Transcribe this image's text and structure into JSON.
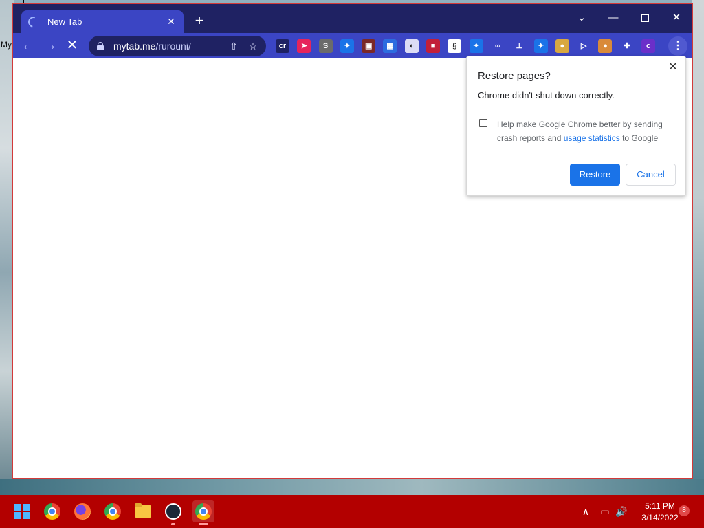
{
  "desktop": {
    "label": "My"
  },
  "tab": {
    "title": "New Tab",
    "close": "✕"
  },
  "new_tab": "+",
  "window_controls": {
    "tab_search": "⌄",
    "minimize": "—",
    "close": "✕"
  },
  "nav": {
    "back": "←",
    "forward": "→",
    "stop": "✕"
  },
  "address": {
    "domain": "mytab.me",
    "path": "/rurouni/"
  },
  "omnibox_icons": {
    "share": "⇧",
    "bookmark": "☆"
  },
  "extensions": [
    {
      "name": "cr-extension-icon",
      "text": "cr",
      "color": "#1f2263"
    },
    {
      "name": "pointer-extension-icon",
      "text": "➤",
      "color": "#e6245c"
    },
    {
      "name": "s-extension-icon",
      "text": "S",
      "color": "#6b6b6b"
    },
    {
      "name": "puzzle-blue-extension-icon",
      "text": "✦",
      "color": "#1a73e8"
    },
    {
      "name": "red-box-extension-icon",
      "text": "▣",
      "color": "#7a2828"
    },
    {
      "name": "grid-extension-icon",
      "text": "▦",
      "color": "#2d6cdf"
    },
    {
      "name": "flag-extension-icon",
      "text": "◐",
      "color": "#dcdcf5"
    },
    {
      "name": "red-square-extension-icon",
      "text": "■",
      "color": "#c21f3a"
    },
    {
      "name": "clip-extension-icon",
      "text": "§",
      "color": "#ffffff"
    },
    {
      "name": "puzzle-blue-2-extension-icon",
      "text": "✦",
      "color": "#1a73e8"
    },
    {
      "name": "link-extension-icon",
      "text": "∞",
      "color": "#3b45c4"
    },
    {
      "name": "stamp-extension-icon",
      "text": "⊥",
      "color": "#3b45c4"
    },
    {
      "name": "puzzle-blue-3-extension-icon",
      "text": "✦",
      "color": "#1a73e8"
    },
    {
      "name": "doge-extension-icon",
      "text": "●",
      "color": "#d8a840"
    },
    {
      "name": "play-extension-icon",
      "text": "▷",
      "color": "#3b45c4"
    },
    {
      "name": "monkey-extension-icon",
      "text": "●",
      "color": "#d98a3a"
    },
    {
      "name": "puzzle-extension-icon",
      "text": "✚",
      "color": "#3b45c4"
    },
    {
      "name": "c-extension-icon",
      "text": "c",
      "color": "#6b2fc9"
    }
  ],
  "menu": "⋮",
  "dialog": {
    "title": "Restore pages?",
    "message": "Chrome didn't shut down correctly.",
    "consent_before": "Help make Google Chrome better by sending crash reports and ",
    "consent_link": "usage statistics",
    "consent_after": " to Google",
    "restore": "Restore",
    "cancel": "Cancel",
    "close": "✕"
  },
  "taskbar": {
    "time": "5:11 PM",
    "date": "3/14/2022",
    "notifications": "8",
    "tray_chevron": "∧",
    "network": "▭",
    "volume": "🔊"
  },
  "colors": {
    "titlebar": "#1f2263",
    "toolbar": "#3b45c4",
    "taskbar": "#b30000",
    "accent": "#1a73e8"
  }
}
